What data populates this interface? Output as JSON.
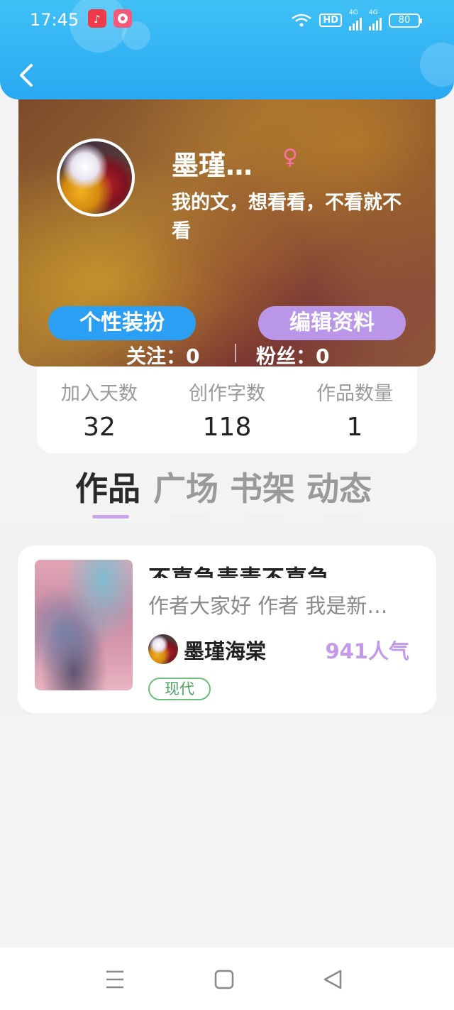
{
  "status_bar": {
    "time": "17:45",
    "battery": "80",
    "network": "4G",
    "hd": "HD"
  },
  "colors": {
    "header_blue": "#2aa9f2",
    "accent_purple": "#c49ae8",
    "pill_blue": "#2a9ff3",
    "pill_purple": "#b996e8",
    "tag_green": "#4aa45e"
  },
  "profile": {
    "nickname": "墨瑾…",
    "gender_symbol": "♀",
    "bio": "我的文，想看看，不看就不看",
    "style_button": "个性装扮",
    "edit_button": "编辑资料",
    "following": "关注：0",
    "followers": "粉丝：0"
  },
  "stats": [
    {
      "label": "加入天数",
      "value": "32"
    },
    {
      "label": "创作字数",
      "value": "118"
    },
    {
      "label": "作品数量",
      "value": "1"
    }
  ],
  "tabs": [
    {
      "label": "作品"
    },
    {
      "label": "广场"
    },
    {
      "label": "书架"
    },
    {
      "label": "动态"
    }
  ],
  "works": [
    {
      "title": "不喜急毒毒不喜急",
      "description": "作者大家好 作者 我是新…",
      "author": "墨瑾海棠",
      "popularity": "941人气",
      "tag": "现代"
    }
  ]
}
